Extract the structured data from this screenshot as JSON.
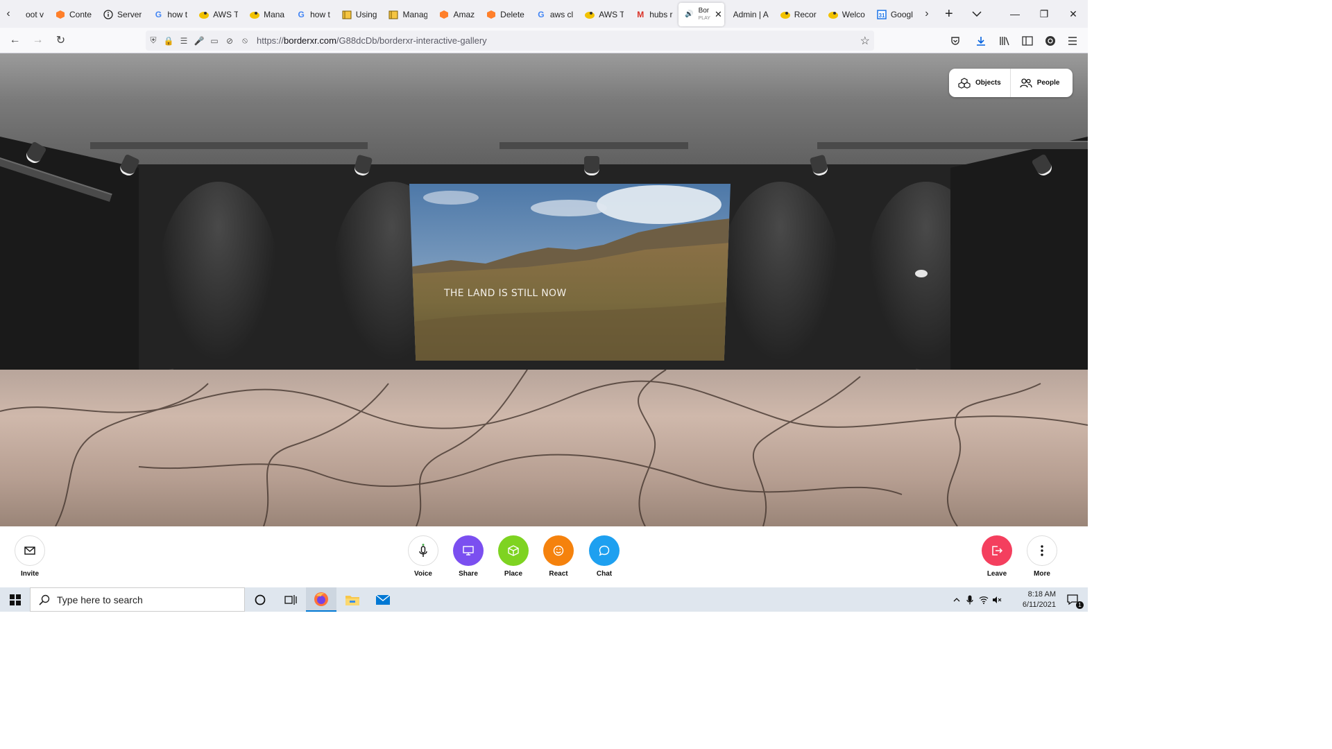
{
  "browser": {
    "tabs": [
      {
        "label": "oot v",
        "icon": "page-icon"
      },
      {
        "label": "Conte",
        "icon": "aws-cube-icon"
      },
      {
        "label": "Server",
        "icon": "info-icon"
      },
      {
        "label": "how t",
        "icon": "google-icon"
      },
      {
        "label": "AWS T",
        "icon": "duck-icon"
      },
      {
        "label": "Mana",
        "icon": "duck-icon"
      },
      {
        "label": "how t",
        "icon": "google-icon"
      },
      {
        "label": "Using",
        "icon": "box-icon"
      },
      {
        "label": "Manag",
        "icon": "box-icon"
      },
      {
        "label": "Amaz",
        "icon": "aws-cube-icon"
      },
      {
        "label": "Delete",
        "icon": "aws-cube-icon"
      },
      {
        "label": "aws cl",
        "icon": "google-icon"
      },
      {
        "label": "AWS T",
        "icon": "duck-icon"
      },
      {
        "label": "hubs r",
        "icon": "gmail-icon"
      }
    ],
    "active_tab": {
      "label": "Bor",
      "sublabel": "PLAY"
    },
    "tabs_after": [
      {
        "label": "Admin | A",
        "icon": "none"
      },
      {
        "label": "Recor",
        "icon": "duck-icon"
      },
      {
        "label": "Welco",
        "icon": "duck-icon"
      },
      {
        "label": "Googl",
        "icon": "calendar-icon"
      }
    ],
    "url_prefix": "https://",
    "url_domain": "borderxr.com",
    "url_path": "/G88dcDb/borderxr-interactive-gallery"
  },
  "scene": {
    "painting_caption": "THE LAND IS STILL NOW"
  },
  "panel": {
    "objects_label": "Objects",
    "people_label": "People"
  },
  "toolbar": {
    "invite": "Invite",
    "voice": "Voice",
    "share": "Share",
    "place": "Place",
    "react": "React",
    "chat": "Chat",
    "leave": "Leave",
    "more": "More"
  },
  "colors": {
    "share": "#7b4ff0",
    "place": "#7ed321",
    "react": "#f5820d",
    "chat": "#1ea0f0",
    "leave": "#f43f5e"
  },
  "taskbar": {
    "search_placeholder": "Type here to search",
    "time": "8:18 AM",
    "date": "6/11/2021",
    "notification_count": "1"
  }
}
